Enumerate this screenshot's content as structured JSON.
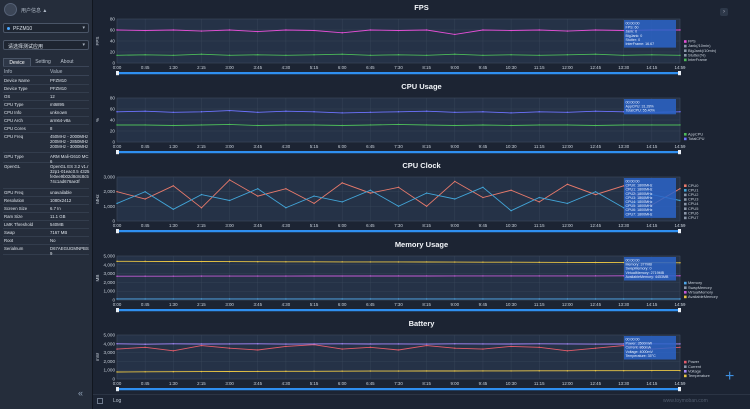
{
  "user": {
    "name": "用户信息 ▲"
  },
  "device_select": {
    "value": "PFZM10"
  },
  "app_select": {
    "value": "请选择测试应用"
  },
  "tabs": [
    "Device",
    "Setting",
    "About"
  ],
  "info_header": {
    "key": "Info",
    "value": "Value"
  },
  "info_rows": [
    {
      "k": "Device Name",
      "v": "PFZM10"
    },
    {
      "k": "Device Type",
      "v": "PFZM10"
    },
    {
      "k": "OS",
      "v": "12"
    },
    {
      "k": "CPU Type",
      "v": "mt6895"
    },
    {
      "k": "CPU Info",
      "v": "unknown"
    },
    {
      "k": "CPU Arch",
      "v": "arm64-v8a"
    },
    {
      "k": "CPU Cores",
      "v": "8"
    },
    {
      "k": "CPU Freq",
      "v": "450MHz - 2000MHz 200MHz - 2850MHz 200MHz - 3000MHz"
    },
    {
      "k": "GPU Type",
      "v": "ARM Mali-G610 MC6"
    },
    {
      "k": "OpenGL",
      "v": "OpenGL ES 3.2 v1.r32p1-01eac0.5 4325fe0ee9b02d8c8c8c574c1ad676ae3f"
    },
    {
      "k": "GPU Freq",
      "v": "unavailable"
    },
    {
      "k": "Resolution",
      "v": "1080x2412"
    },
    {
      "k": "Screen Size",
      "v": "6.7 In"
    },
    {
      "k": "Ram Size",
      "v": "11.1 GB"
    },
    {
      "k": "LMK Threshold",
      "v": "540MB"
    },
    {
      "k": "Swap",
      "v": "7167 MB"
    },
    {
      "k": "Root",
      "v": "No"
    },
    {
      "k": "Serialnum",
      "v": "D67AEGUGMNPBS9"
    }
  ],
  "bottom": {
    "log": "Log",
    "watermark": "www.toymoban.com"
  },
  "colors": {
    "accent": "#2f8ff0",
    "panel": "#253247"
  },
  "xticks": [
    "0:00",
    "0:45",
    "1:30",
    "2:15",
    "3:00",
    "3:45",
    "4:30",
    "5:15",
    "6:00",
    "6:45",
    "7:30",
    "8:15",
    "9:00",
    "9:45",
    "10:30",
    "11:15",
    "12:00",
    "12:45",
    "13:30",
    "14:15",
    "14:59"
  ],
  "chart_data": [
    {
      "type": "line",
      "title": "FPS",
      "ylabel": "FPS",
      "yticks": [
        "0",
        "20",
        "40",
        "60",
        "80"
      ],
      "ylim": [
        0,
        80
      ],
      "legend": [
        "FPS",
        "Jank(/10min)",
        "BigJank(/10min)",
        "Stutter(%)",
        "InterFrame"
      ],
      "series": [
        {
          "name": "FPS",
          "color": "#e34fd6",
          "values": [
            60,
            59,
            60,
            58,
            60,
            57,
            60,
            59,
            55,
            60,
            59,
            60,
            52,
            60,
            59,
            60,
            58,
            60,
            59,
            60,
            60
          ]
        },
        {
          "name": "InterFrame",
          "color": "#4dbb5a",
          "values": [
            14,
            15,
            14,
            16,
            14,
            15,
            14,
            15,
            16,
            14,
            15,
            14,
            16,
            14,
            15,
            14,
            15,
            16,
            14,
            15,
            14
          ]
        }
      ],
      "tooltip": [
        "00:00:00",
        "FPS: 60",
        "Jank: 0",
        "BigJank: 0",
        "Stutter: 0",
        "InterFrame: 16.67"
      ]
    },
    {
      "type": "line",
      "title": "CPU Usage",
      "ylabel": "%",
      "yticks": [
        "0",
        "20",
        "40",
        "60",
        "80"
      ],
      "ylim": [
        0,
        80
      ],
      "legend": [
        "AppCPU",
        "TotalCPU"
      ],
      "series": [
        {
          "name": "TotalCPU",
          "color": "#6d73ff",
          "values": [
            55,
            56,
            54,
            55,
            57,
            54,
            56,
            55,
            53,
            54,
            55,
            56,
            54,
            55,
            53,
            55,
            54,
            56,
            55,
            54,
            55
          ]
        },
        {
          "name": "AppCPU",
          "color": "#4dbb5a",
          "values": [
            31,
            31,
            30,
            31,
            32,
            30,
            31,
            31,
            30,
            31,
            32,
            31,
            30,
            31,
            30,
            31,
            31,
            30,
            31,
            31,
            31
          ]
        }
      ],
      "tooltip": [
        "00:00:00",
        "AppCPU: 31.28%",
        "TotalCPU: 55.40%"
      ]
    },
    {
      "type": "line",
      "title": "CPU Clock",
      "ylabel": "MHz",
      "yticks": [
        "0",
        "1,000",
        "2,000",
        "3,000"
      ],
      "ylim": [
        0,
        3000
      ],
      "legend": [
        "CPU0",
        "CPU1",
        "CPU2",
        "CPU3",
        "CPU4",
        "CPU5",
        "CPU6",
        "CPU7"
      ],
      "series": [
        {
          "name": "CPU0",
          "color": "#e87a6b",
          "values": [
            2000,
            1500,
            2400,
            900,
            2800,
            1700,
            2200,
            1200,
            2600,
            1900,
            2300,
            1000,
            2700,
            1600,
            2100,
            1300,
            2500,
            1800,
            2400,
            1100,
            2200
          ]
        },
        {
          "name": "CPU1",
          "color": "#42a5d8",
          "values": [
            1200,
            2000,
            800,
            1800,
            1400,
            2200,
            900,
            1700,
            1300,
            2100,
            1000,
            1900,
            1500,
            2300,
            700,
            1600,
            1200,
            2000,
            900,
            1800,
            1400
          ]
        }
      ],
      "tooltip": [
        "00:00:00",
        "CPU0: 1800MHz",
        "CPU1: 1800MHz",
        "CPU2: 1800MHz",
        "CPU3: 1800MHz",
        "CPU4: 1800MHz",
        "CPU5: 1800MHz",
        "CPU6: 1800MHz",
        "CPU7: 1800MHz"
      ]
    },
    {
      "type": "line",
      "title": "Memory Usage",
      "ylabel": "MB",
      "yticks": [
        "0",
        "1,000",
        "2,000",
        "3,000",
        "4,000",
        "5,000"
      ],
      "ylim": [
        0,
        5000
      ],
      "legend": [
        "Memory",
        "SwapMemory",
        "VirtualMemory",
        "AvailableMemory"
      ],
      "series": [
        {
          "name": "AvailableMemory",
          "color": "#e8c443",
          "values": [
            4400,
            4390,
            4380,
            4370,
            4360,
            4350,
            4345,
            4340,
            4335,
            4330,
            4325,
            4320,
            4310,
            4300,
            4290,
            4280,
            4270,
            4260,
            4250,
            4240,
            4230
          ]
        },
        {
          "name": "VirtualMemory",
          "color": "#c45bd6",
          "values": [
            2700,
            2705,
            2710,
            2712,
            2715,
            2718,
            2720,
            2722,
            2725,
            2728,
            2730,
            2732,
            2734,
            2736,
            2738,
            2740,
            2742,
            2744,
            2746,
            2748,
            2750
          ]
        },
        {
          "name": "Memory",
          "color": "#4ea7e8",
          "values": [
            120,
            120,
            120,
            120,
            120,
            120,
            120,
            120,
            120,
            120,
            120,
            120,
            120,
            120,
            120,
            120,
            120,
            120,
            120,
            120,
            120
          ]
        }
      ],
      "tooltip": [
        "00:00:00",
        "Memory: 377MB",
        "SwapMemory: 0",
        "VirtualMemory: 2719MB",
        "AvailableMemory: 4453MB"
      ]
    },
    {
      "type": "line",
      "title": "Battery",
      "ylabel": "mW",
      "yticks": [
        "0",
        "1,000",
        "2,000",
        "3,000",
        "4,000",
        "5,000"
      ],
      "ylim": [
        0,
        5000
      ],
      "legend": [
        "Power",
        "Current",
        "Voltage",
        "Temperature"
      ],
      "series": [
        {
          "name": "Power",
          "color": "#e35c6b",
          "values": [
            3400,
            3600,
            3200,
            3800,
            3500,
            3300,
            3700,
            3900,
            3400,
            3600,
            3300,
            3800,
            3500,
            3400,
            3700,
            3600,
            3200,
            3500,
            3800,
            3400,
            3600
          ]
        },
        {
          "name": "Voltage",
          "color": "#a98bff",
          "values": [
            4000,
            3950,
            4000,
            3980,
            3990,
            4000,
            3970,
            3990,
            4000,
            3980,
            3990,
            3970,
            4000,
            3990,
            3980,
            4000,
            3990,
            3970,
            3980,
            4000,
            3990
          ]
        },
        {
          "name": "Temperature",
          "color": "#e8c443",
          "values": [
            800,
            820,
            830,
            840,
            850,
            860,
            870,
            880,
            890,
            900,
            900,
            910,
            910,
            920,
            920,
            930,
            930,
            940,
            940,
            950,
            950
          ]
        }
      ],
      "tooltip": [
        "00:00:00",
        "Power: 3500mW",
        "Current: 860mA",
        "Voltage: 4000mV",
        "Temperature: 35°C"
      ]
    }
  ]
}
